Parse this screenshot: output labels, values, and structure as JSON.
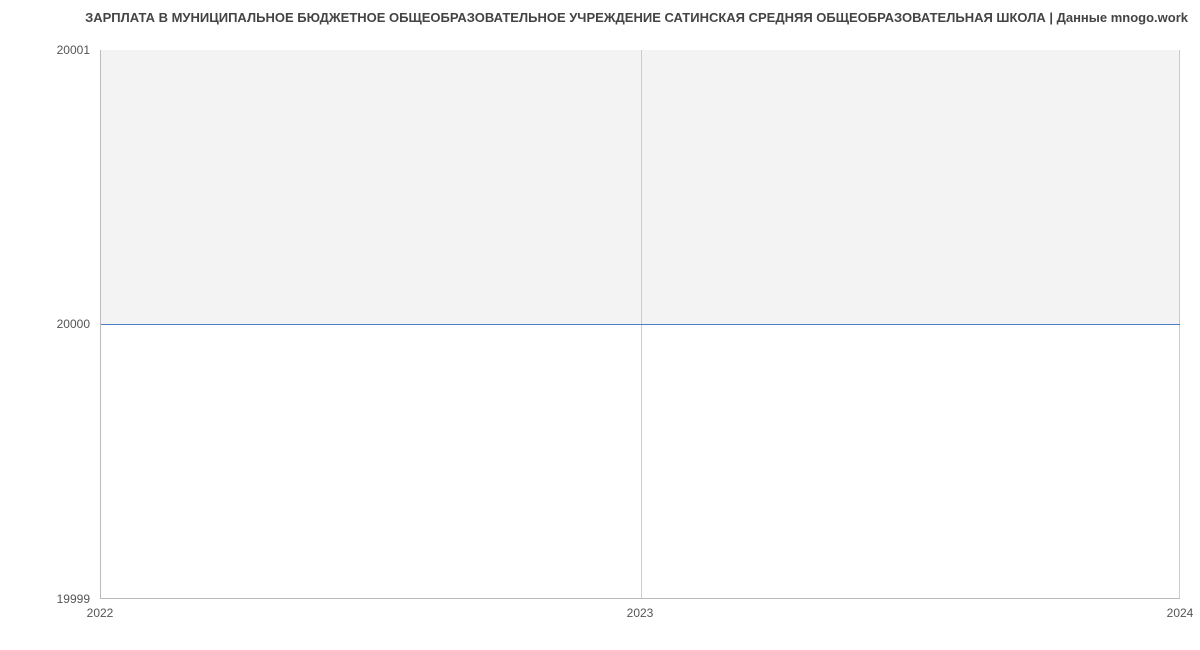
{
  "chart_data": {
    "type": "area",
    "title": "ЗАРПЛАТА В МУНИЦИПАЛЬНОЕ БЮДЖЕТНОЕ ОБЩЕОБРАЗОВАТЕЛЬНОЕ УЧРЕЖДЕНИЕ САТИНСКАЯ СРЕДНЯЯ ОБЩЕОБРАЗОВАТЕЛЬНАЯ ШКОЛА | Данные mnogo.work",
    "x": [
      2022,
      2023,
      2024
    ],
    "values": [
      20000,
      20000,
      20000
    ],
    "xlabel": "",
    "ylabel": "",
    "ylim": [
      19999,
      20001
    ],
    "xlim": [
      2022,
      2024
    ],
    "yticks": [
      19999,
      20000,
      20001
    ],
    "xticks": [
      2022,
      2023,
      2024
    ],
    "line_color": "#4a7ec8",
    "fill_color": "#f3f3f3"
  }
}
